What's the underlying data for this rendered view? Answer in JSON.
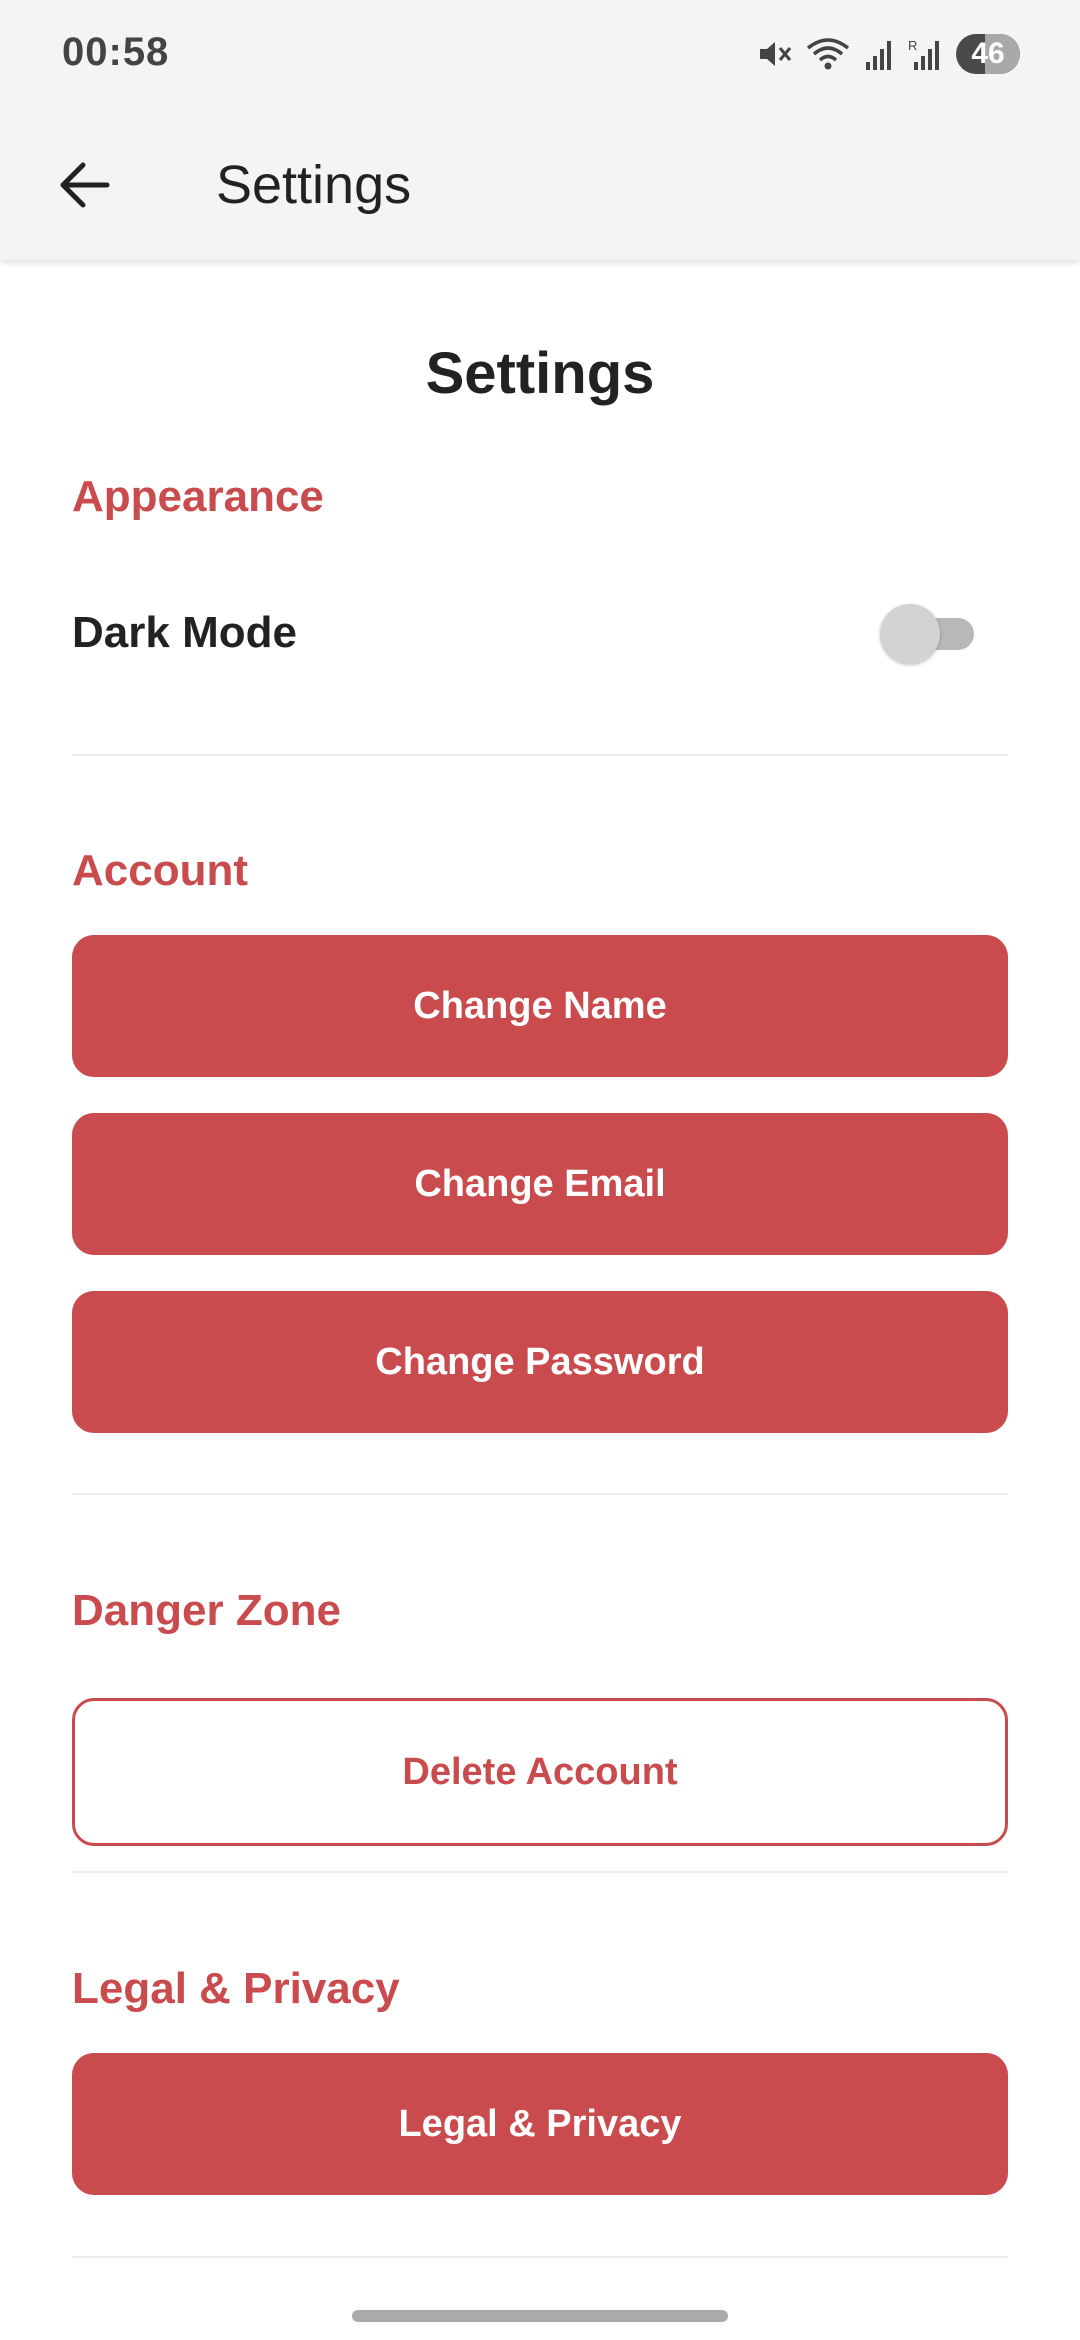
{
  "status_bar": {
    "time": "00:58",
    "battery_level": "46",
    "icons": [
      "mute-icon",
      "wifi-icon",
      "signal-icon",
      "signal-roaming-icon",
      "battery-icon"
    ]
  },
  "app_bar": {
    "title": "Settings",
    "back_icon": "arrow-left-icon"
  },
  "page": {
    "title": "Settings"
  },
  "appearance": {
    "section_title": "Appearance",
    "dark_mode_label": "Dark Mode",
    "dark_mode_enabled": false
  },
  "account": {
    "section_title": "Account",
    "change_name": "Change Name",
    "change_email": "Change Email",
    "change_password": "Change Password"
  },
  "danger_zone": {
    "section_title": "Danger Zone",
    "delete_account": "Delete Account"
  },
  "legal": {
    "section_title": "Legal & Privacy",
    "button": "Legal & Privacy"
  },
  "colors": {
    "accent": "#c94b4d",
    "bar_background": "#f4f4f4",
    "text_primary": "#222222"
  }
}
